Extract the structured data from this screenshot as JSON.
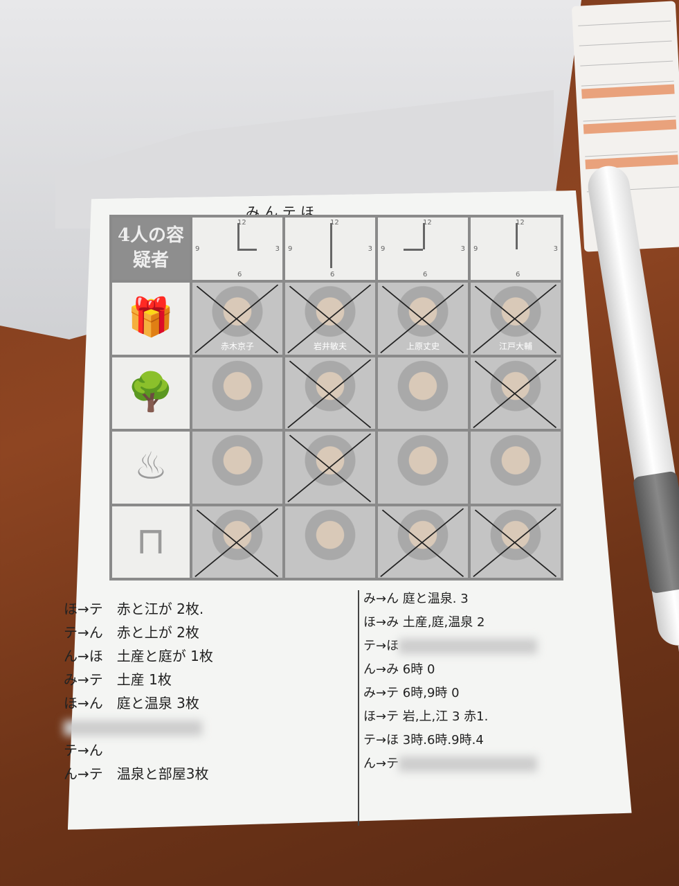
{
  "sheet": {
    "players_line": "み,ん,テ,ほ.",
    "title": "4人の容疑者",
    "clocks": [
      {
        "time": "3:00",
        "hour": 3,
        "minute": 0
      },
      {
        "time": "6:00",
        "hour": 6,
        "minute": 0
      },
      {
        "time": "9:00",
        "hour": 9,
        "minute": 0
      },
      {
        "time": "12:00",
        "hour": 12,
        "minute": 0
      }
    ],
    "clock_numbers": {
      "top": "12",
      "left": "9",
      "right": "3",
      "bottom": "6"
    },
    "rows": [
      {
        "icon": "gift-icon",
        "glyph": "🎁",
        "suspects": [
          {
            "name": "赤木京子",
            "crossed": true
          },
          {
            "name": "岩井敏夫",
            "crossed": true
          },
          {
            "name": "上原丈史",
            "crossed": true
          },
          {
            "name": "江戸大輔",
            "crossed": true
          }
        ]
      },
      {
        "icon": "tree-icon",
        "glyph": "🌳",
        "suspects": [
          {
            "name": "",
            "crossed": false
          },
          {
            "name": "",
            "crossed": true
          },
          {
            "name": "",
            "crossed": false
          },
          {
            "name": "",
            "crossed": true
          }
        ]
      },
      {
        "icon": "hot-spring-icon",
        "glyph": "♨",
        "suspects": [
          {
            "name": "",
            "crossed": false
          },
          {
            "name": "",
            "crossed": true
          },
          {
            "name": "",
            "crossed": false
          },
          {
            "name": "",
            "crossed": false
          }
        ]
      },
      {
        "icon": "table-icon",
        "glyph": "⊓",
        "suspects": [
          {
            "name": "",
            "crossed": true
          },
          {
            "name": "",
            "crossed": false
          },
          {
            "name": "",
            "crossed": true
          },
          {
            "name": "",
            "crossed": true
          }
        ]
      }
    ],
    "notes_left": [
      "ほ→テ　赤と江が 2枚.",
      "テ→ん　赤と上が 2枚",
      "ん→ほ　土産と庭が 1枚",
      "み→テ　土産 1枚",
      "ほ→ん　庭と温泉 3枚",
      "",
      "テ→ん",
      "ん→テ　温泉と部屋3枚"
    ],
    "notes_right": [
      "み→ん 庭と温泉. 3",
      "ほ→み 土産,庭,温泉 2",
      "テ→ほ",
      "ん→み 6時 0",
      "み→テ 6時,9時 0",
      "ほ→テ 岩,上,江 3 赤1.",
      "テ→ほ 3時.6時.9時.4",
      "ん→テ"
    ]
  }
}
